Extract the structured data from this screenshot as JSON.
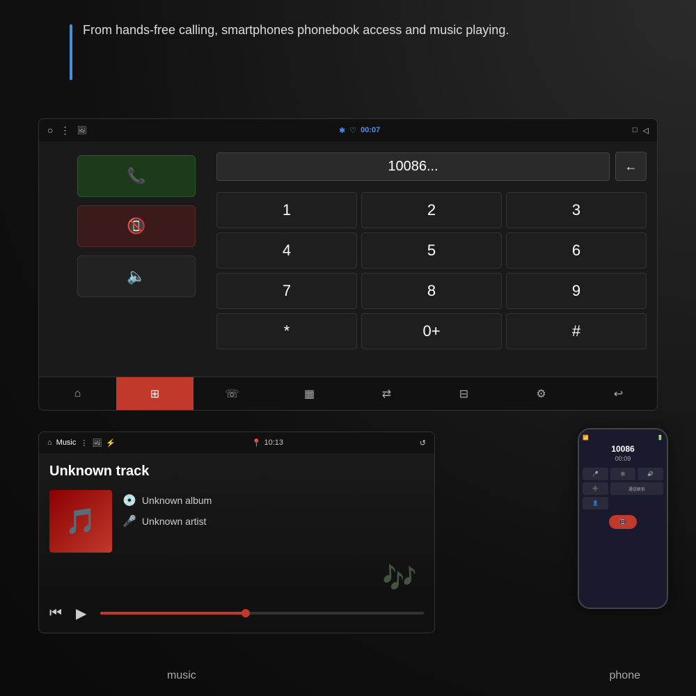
{
  "page": {
    "bg_color": "#1a1a1a"
  },
  "top": {
    "tagline": "From hands-free calling, smartphones phonebook access and music playing."
  },
  "status_bar": {
    "circle": "○",
    "menu": "⋮",
    "time": "00:07",
    "battery": "□",
    "back": "◁"
  },
  "dialpad": {
    "number": "10086...",
    "keys": [
      "1",
      "2",
      "3",
      "4",
      "5",
      "6",
      "7",
      "8",
      "9",
      "*",
      "0+",
      "#"
    ]
  },
  "nav_bar": {
    "items": [
      "⌂",
      "⊞",
      "☏",
      "▦",
      "⇄",
      "⊟",
      "⚙",
      "↩"
    ]
  },
  "music": {
    "status_bar_left": "Music ⋮ 🖼 ♦",
    "status_bar_center": "10:13",
    "status_bar_right": "↺",
    "track_title": "Unknown track",
    "album": "Unknown album",
    "artist": "Unknown artist"
  },
  "labels": {
    "music": "music",
    "phone": "phone"
  },
  "phone_mockup": {
    "number": "10086",
    "time": "00:09",
    "buttons": [
      "🎤",
      "⊞",
      "🔊",
      "➕",
      "通话联系",
      "👤"
    ]
  }
}
